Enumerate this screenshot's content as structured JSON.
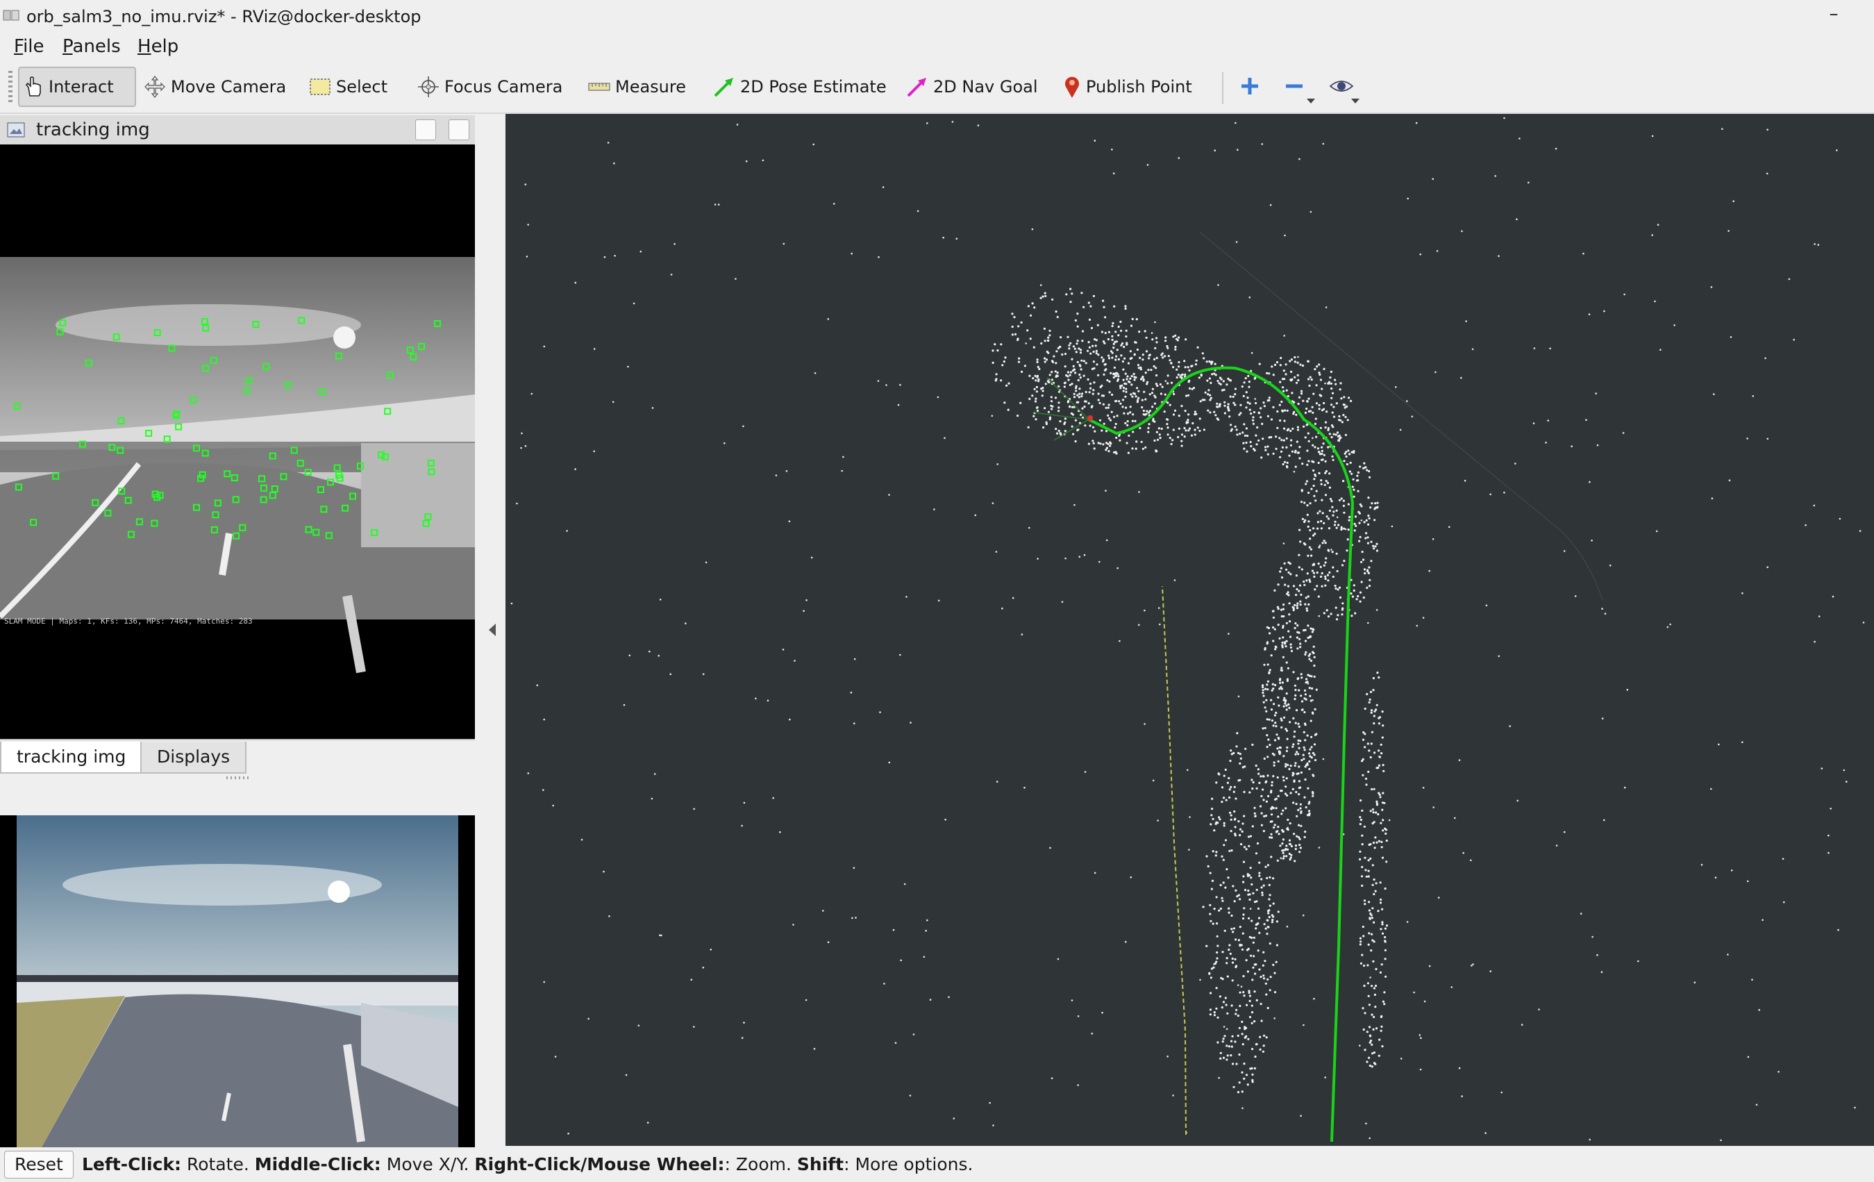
{
  "window": {
    "title": "orb_salm3_no_imu.rviz* - RViz@docker-desktop",
    "minimize": "–"
  },
  "menu": [
    "File",
    "Panels",
    "Help"
  ],
  "toolbar": {
    "tools": [
      {
        "label": "Interact",
        "icon": "hand-cursor-icon",
        "active": true
      },
      {
        "label": "Move Camera",
        "icon": "move-camera-icon"
      },
      {
        "label": "Select",
        "icon": "select-box-icon"
      },
      {
        "label": "Focus Camera",
        "icon": "focus-camera-icon"
      },
      {
        "label": "Measure",
        "icon": "ruler-icon"
      },
      {
        "label": "2D Pose Estimate",
        "icon": "green-arrow-icon",
        "color": "#22c022"
      },
      {
        "label": "2D Nav Goal",
        "icon": "magenta-arrow-icon",
        "color": "#e020c8"
      },
      {
        "label": "Publish Point",
        "icon": "map-pin-icon",
        "color": "#c8321e"
      }
    ],
    "extra_icons": [
      "plus-icon",
      "minus-icon",
      "eye-icon"
    ]
  },
  "dock": {
    "title": "tracking img",
    "overlay_text": "SLAM MODE |  Maps: 1, KFs: 136, MPs: 7464, Matches: 283",
    "tabs": [
      "tracking img",
      "Displays"
    ]
  },
  "status": {
    "reset_label": "Reset",
    "help": [
      {
        "key": "Left-Click:",
        "text": " Rotate. "
      },
      {
        "key": "Middle-Click:",
        "text": " Move X/Y. "
      },
      {
        "key": "Right-Click/Mouse Wheel:",
        "text": ": Zoom. "
      },
      {
        "key": "Shift",
        "text": ": More options."
      }
    ]
  },
  "colors": {
    "background_3d": "#2f3537",
    "trajectory": "#19d419",
    "feature": "#22ff22",
    "path_yellow": "#c8c850"
  }
}
